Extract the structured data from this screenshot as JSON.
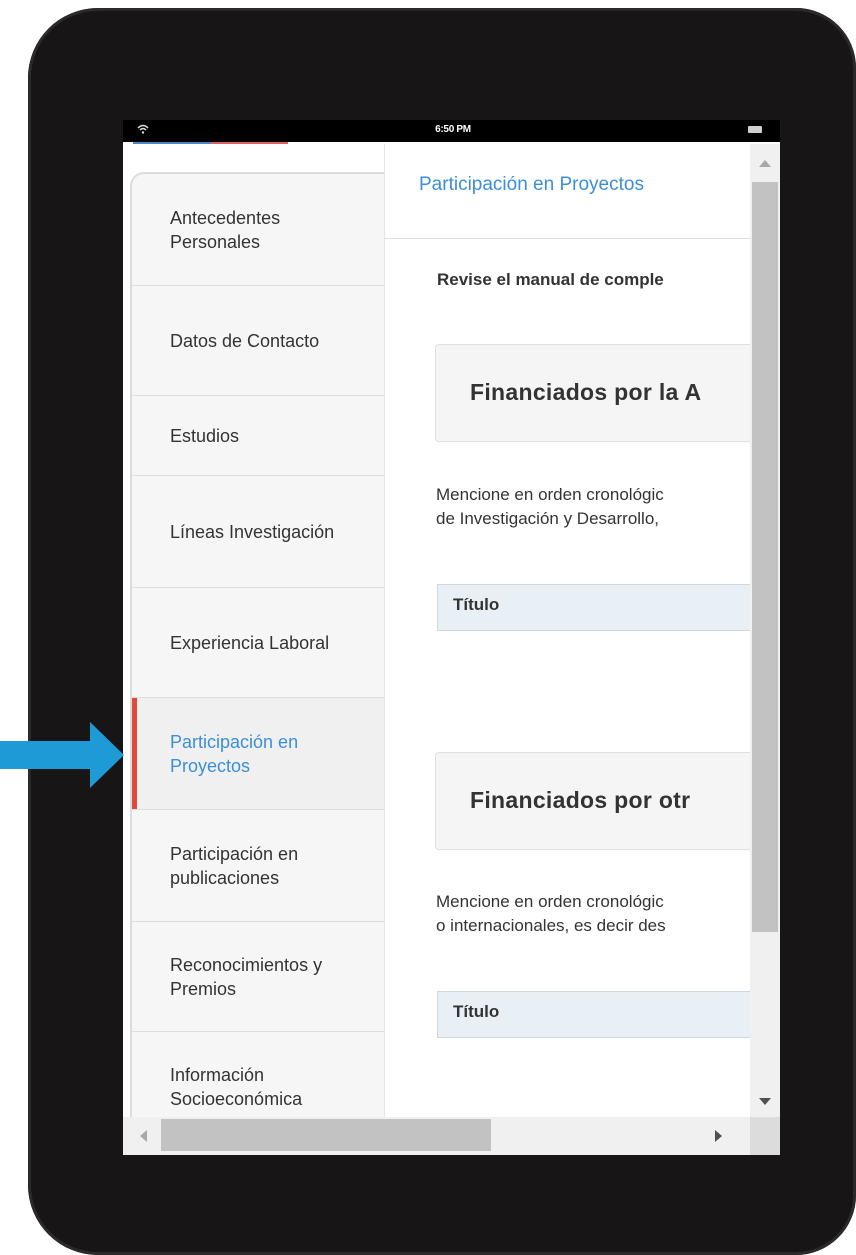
{
  "status_bar": {
    "time": "6:50 PM"
  },
  "sidebar": {
    "items": [
      {
        "label": "Antecedentes Personales",
        "active": false
      },
      {
        "label": "Datos de Contacto",
        "active": false
      },
      {
        "label": "Estudios",
        "active": false
      },
      {
        "label": "Líneas Investigación",
        "active": false
      },
      {
        "label": "Experiencia Laboral",
        "active": false
      },
      {
        "label": "Participación en Proyectos",
        "active": true
      },
      {
        "label": "Participación en publicaciones",
        "active": false
      },
      {
        "label": "Reconocimientos y Premios",
        "active": false
      },
      {
        "label": "Información Socioeconómica",
        "active": false
      }
    ]
  },
  "main": {
    "header_title": "Participación en Proyectos",
    "intro": "Revise el manual de comple",
    "sections": [
      {
        "title": "Financiados por la A",
        "description_lines": [
          "Mencione en orden cronológic",
          "de Investigación y Desarrollo,"
        ],
        "table_header": "Título"
      },
      {
        "title": "Financiados por otr",
        "description_lines": [
          "Mencione en orden cronológic",
          "o internacionales, es decir des"
        ],
        "table_header": "Título"
      }
    ]
  },
  "colors": {
    "accent_blue": "#3b8fd8",
    "active_marker_red": "#e04a3c",
    "callout_arrow": "#1e9ad6",
    "device_frame": "#171515"
  },
  "icons": [
    "wifi-icon",
    "battery-icon",
    "callout-arrow-icon"
  ]
}
